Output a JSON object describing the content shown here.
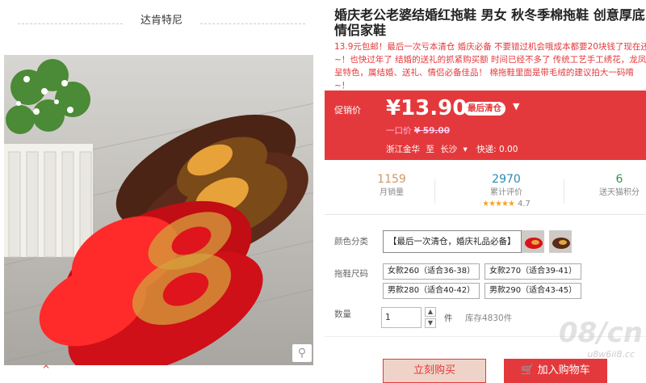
{
  "shop": {
    "name": "达肯特尼"
  },
  "product": {
    "title": "婚庆老公老婆结婚红拖鞋 男女 秋冬季棉拖鞋 创意厚底情侣家鞋",
    "subtitle": "13.9元包邮！最后一次亏本清仓 婚庆必备 不要错过机会哦成本都要20块钱了现在还~！也快过年了 结婚的送礼的抓紧购买额 时间已经不多了 传统工艺手工绣花，龙凤呈特色，属结婚、送礼、情侣必备佳品！ 棉拖鞋里面是带毛绒的建议拍大一码唷~！"
  },
  "price": {
    "label": "促销价",
    "current": "¥13.90",
    "badge": "最后清仓",
    "original_label": "一口价",
    "original": "¥ 59.00",
    "ship_from": "浙江金华",
    "ship_to_word": "至",
    "ship_to": "长沙",
    "express": "快递: 0.00"
  },
  "stats": {
    "sales": {
      "value": "1159",
      "label": "月销量"
    },
    "reviews": {
      "value": "2970",
      "label": "累计评价",
      "rating": "4.7"
    },
    "points": {
      "value": "6",
      "label": "送天猫积分"
    }
  },
  "options": {
    "color_label": "颜色分类",
    "color_selected": "【最后一次清仓，婚庆礼品必备】",
    "size_label": "拖鞋尺码",
    "sizes": [
      "女款260（适合36-38）",
      "女款270（适合39-41）",
      "男款280（适合40-42）",
      "男款290（适合43-45）"
    ],
    "qty_label": "数量",
    "qty_value": "1",
    "unit": "件",
    "stock": "库存4830件"
  },
  "actions": {
    "buy": "立刻购买",
    "cart": "加入购物车"
  },
  "watermark": {
    "big": "08/cn",
    "small": "u8w6ii8.cc"
  },
  "colors": {
    "accent": "#e4393c"
  },
  "icons": {
    "zoom": "magnifier-icon",
    "dropdown": "chevron-down-icon"
  }
}
